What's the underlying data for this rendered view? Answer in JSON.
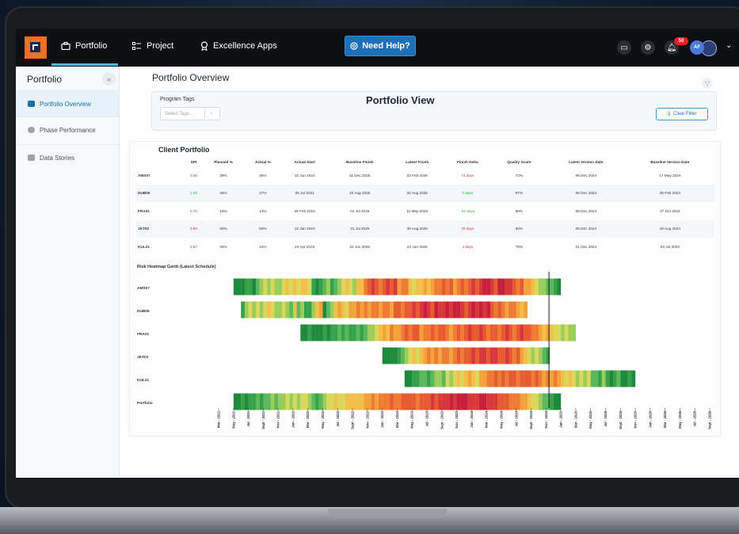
{
  "nav": {
    "portfolio": "Portfolio",
    "project": "Project",
    "excellence_apps": "Excellence Apps",
    "help": "Need Help?",
    "notifications_count": "50",
    "avatar_initials": "AF"
  },
  "sidebar": {
    "title": "Portfolio",
    "items": [
      {
        "label": "Portfolio Overview",
        "active": true
      },
      {
        "label": "Phase Performance",
        "active": false
      },
      {
        "label": "Data Stories",
        "active": false
      }
    ]
  },
  "main": {
    "title": "Portfolio Overview",
    "program_tags_label": "Program Tags",
    "select_tags_placeholder": "Select Tags...",
    "portfolio_view_title": "Portfolio View",
    "clear_filter": "Clear Filter",
    "client_portfolio": "Client Portfolio"
  },
  "table": {
    "headers": [
      "",
      "SPI",
      "Planned %",
      "Actual %",
      "Actual Start",
      "Baseline Finish",
      "Latest Finish",
      "Finish Delta",
      "Quality Score",
      "Latest Version Date",
      "Baseline Version Date"
    ],
    "rows": [
      {
        "project": "AMS07",
        "spi": "0.66",
        "spi_status": "red",
        "planned": "39%",
        "actual": "25%",
        "actual_start": "10 Jun 2021",
        "baseline_finish": "11 Dec 2025",
        "latest_finish": "23 Feb 2026",
        "finish_delta": "74 days",
        "delta_status": "red",
        "quality": "72%",
        "latest_version": "06 Dec 2024",
        "baseline_version": "17 May 2024"
      },
      {
        "project": "DUB05",
        "spi": "1.02",
        "spi_status": "green",
        "planned": "46%",
        "actual": "47%",
        "actual_start": "05 Jul 2021",
        "baseline_finish": "20 Aug 2025",
        "latest_finish": "20 Aug 2025",
        "finish_delta": "0 days",
        "delta_status": "green",
        "quality": "87%",
        "latest_version": "06 Dec 2024",
        "baseline_version": "29 Feb 2024"
      },
      {
        "project": "FRA01",
        "spi": "0.76",
        "spi_status": "red",
        "planned": "18%",
        "actual": "14%",
        "actual_start": "28 Feb 2022",
        "baseline_finish": "01 Jul 2026",
        "latest_finish": "11 May 2026",
        "finish_delta": "-51 days",
        "delta_status": "green",
        "quality": "89%",
        "latest_version": "08 Dec 2024",
        "baseline_version": "27 Oct 2024"
      },
      {
        "project": "JKT02",
        "spi": "0.83",
        "spi_status": "red",
        "planned": "60%",
        "actual": "50%",
        "actual_start": "12 Jan 2023",
        "baseline_finish": "31 Jul 2025",
        "latest_finish": "30 Aug 2025",
        "finish_delta": "30 days",
        "delta_status": "red",
        "quality": "83%",
        "latest_version": "08 Dec 2024",
        "baseline_version": "18 Aug 2024"
      },
      {
        "project": "KUL21",
        "spi": "0.67",
        "spi_status": "red",
        "planned": "36%",
        "actual": "24%",
        "actual_start": "23 Apr 2023",
        "baseline_finish": "22 Jun 2026",
        "latest_finish": "24 Jun 2026",
        "finish_delta": "2 days",
        "delta_status": "red",
        "quality": "78%",
        "latest_version": "01 Dec 2024",
        "baseline_version": "03 Jul 2023"
      }
    ]
  },
  "chart_data": {
    "type": "heatmap",
    "title": "Risk Heatmap Gantt (Latest Schedule)",
    "x_ticks": [
      "Mar - 2021",
      "May - 2021",
      "Jul - 2021",
      "Sept - 2021",
      "Nov - 2021",
      "Jan - 2022",
      "Mar - 2022",
      "May - 2022",
      "Jul - 2022",
      "Sept - 2022",
      "Nov - 2022",
      "Jan - 2023",
      "Mar - 2023",
      "May - 2023",
      "Jul - 2023",
      "Sept - 2023",
      "Nov - 2023",
      "Jan - 2024",
      "Mar - 2024",
      "May - 2024",
      "Jul - 2024",
      "Sept - 2024",
      "Nov - 2024",
      "Jan - 2025",
      "Mar - 2025",
      "May - 2025",
      "Jul - 2025",
      "Sept - 2025",
      "Nov - 2025",
      "Jan - 2026",
      "Mar - 2026",
      "May - 2026",
      "Jul - 2026",
      "Sept - 2026"
    ],
    "marker": "Nov - 2024",
    "color_scale": [
      "#1e8a3e",
      "#35a24b",
      "#5cb85c",
      "#9ccc5a",
      "#d9d85a",
      "#f2c04a",
      "#f4a23c",
      "#f07c33",
      "#e65c30",
      "#d9383a",
      "#c8203a"
    ],
    "rows": [
      {
        "name": "AMS07",
        "start": "May - 2021",
        "levels": [
          0,
          0,
          0,
          1,
          1,
          0,
          2,
          3,
          4,
          3,
          4,
          3,
          3,
          4,
          5,
          4,
          5,
          4,
          5,
          5,
          4,
          1,
          0,
          1,
          2,
          3,
          1,
          2,
          3,
          4,
          5,
          4,
          3,
          5,
          5,
          7,
          8,
          9,
          8,
          7,
          8,
          9,
          8,
          9,
          6,
          7,
          7,
          5,
          4,
          5,
          5,
          6,
          5,
          6,
          7,
          7,
          8,
          7,
          8,
          6,
          7,
          8,
          7,
          8,
          9,
          8,
          9,
          10,
          10,
          9,
          8,
          10,
          10,
          9,
          9,
          8,
          7,
          8,
          6,
          6,
          5,
          4,
          3,
          3,
          2,
          2,
          1,
          0
        ]
      },
      {
        "name": "DUB05",
        "start": "Jun - 2021",
        "levels": [
          1,
          3,
          4,
          3,
          4,
          3,
          4,
          5,
          4,
          3,
          3,
          4,
          3,
          2,
          5,
          2,
          3,
          1,
          1,
          3,
          5,
          6,
          0,
          2,
          3,
          5,
          6,
          5,
          4,
          6,
          6,
          7,
          6,
          7,
          6,
          7,
          7,
          6,
          7,
          7,
          6,
          8,
          8,
          7,
          8,
          8,
          9,
          8,
          9,
          10,
          9,
          8,
          10,
          9,
          9,
          10,
          9,
          10,
          10,
          9,
          8,
          9,
          10,
          9,
          10,
          9,
          10,
          8,
          7,
          8,
          7,
          6,
          7,
          7,
          6,
          5,
          6
        ]
      },
      {
        "name": "FRA01",
        "start": "Feb - 2022",
        "levels": [
          0,
          0,
          1,
          0,
          0,
          0,
          1,
          0,
          1,
          1,
          2,
          1,
          2,
          1,
          1,
          2,
          1,
          2,
          3,
          3,
          4,
          5,
          6,
          5,
          7,
          6,
          6,
          7,
          8,
          7,
          8,
          8,
          6,
          7,
          7,
          8,
          7,
          8,
          8,
          7,
          6,
          7,
          8,
          7,
          8,
          9,
          8,
          8,
          9,
          8,
          7,
          8,
          8,
          7,
          8,
          9,
          8,
          7,
          8,
          9,
          8,
          8,
          7,
          7,
          6,
          5,
          6,
          5,
          4,
          4,
          3,
          4,
          3,
          3
        ]
      },
      {
        "name": "JKT02",
        "start": "Jan - 2023",
        "levels": [
          0,
          0,
          0,
          0,
          1,
          2,
          3,
          4,
          5,
          4,
          5,
          6,
          7,
          6,
          7,
          6,
          7,
          7,
          6,
          7,
          8,
          7,
          8,
          8,
          9,
          8,
          9,
          9,
          8,
          9,
          9,
          8,
          8,
          9,
          8,
          7,
          8,
          6,
          5,
          4,
          3,
          4,
          3,
          2,
          1
        ]
      },
      {
        "name": "KUL21",
        "start": "Apr - 2023",
        "levels": [
          0,
          0,
          1,
          1,
          2,
          2,
          1,
          2,
          3,
          3,
          2,
          4,
          3,
          4,
          5,
          4,
          5,
          6,
          5,
          4,
          6,
          6,
          7,
          7,
          8,
          7,
          8,
          7,
          8,
          8,
          7,
          8,
          8,
          8,
          7,
          8,
          7,
          6,
          7,
          6,
          7,
          6,
          5,
          4,
          5,
          4,
          3,
          4,
          3,
          4,
          2,
          2,
          1,
          3,
          1,
          0,
          1,
          2,
          0,
          0,
          1,
          0
        ]
      },
      {
        "name": "Portfolio",
        "start": "May - 2021",
        "levels": [
          0,
          0,
          1,
          0,
          1,
          1,
          2,
          1,
          2,
          2,
          3,
          2,
          3,
          3,
          4,
          3,
          4,
          3,
          4,
          4,
          3,
          2,
          1,
          2,
          3,
          4,
          4,
          5,
          4,
          4,
          5,
          5,
          5,
          5,
          5,
          6,
          6,
          7,
          6,
          7,
          7,
          7,
          8,
          7,
          7,
          8,
          8,
          8,
          8,
          7,
          8,
          8,
          8,
          9,
          8,
          9,
          9,
          9,
          10,
          9,
          10,
          10,
          10,
          9,
          9,
          9,
          10,
          10,
          9,
          9,
          9,
          8,
          8,
          8,
          7,
          7,
          7,
          6,
          6,
          5,
          4,
          4,
          3,
          2,
          2,
          1,
          0,
          0
        ]
      }
    ]
  }
}
